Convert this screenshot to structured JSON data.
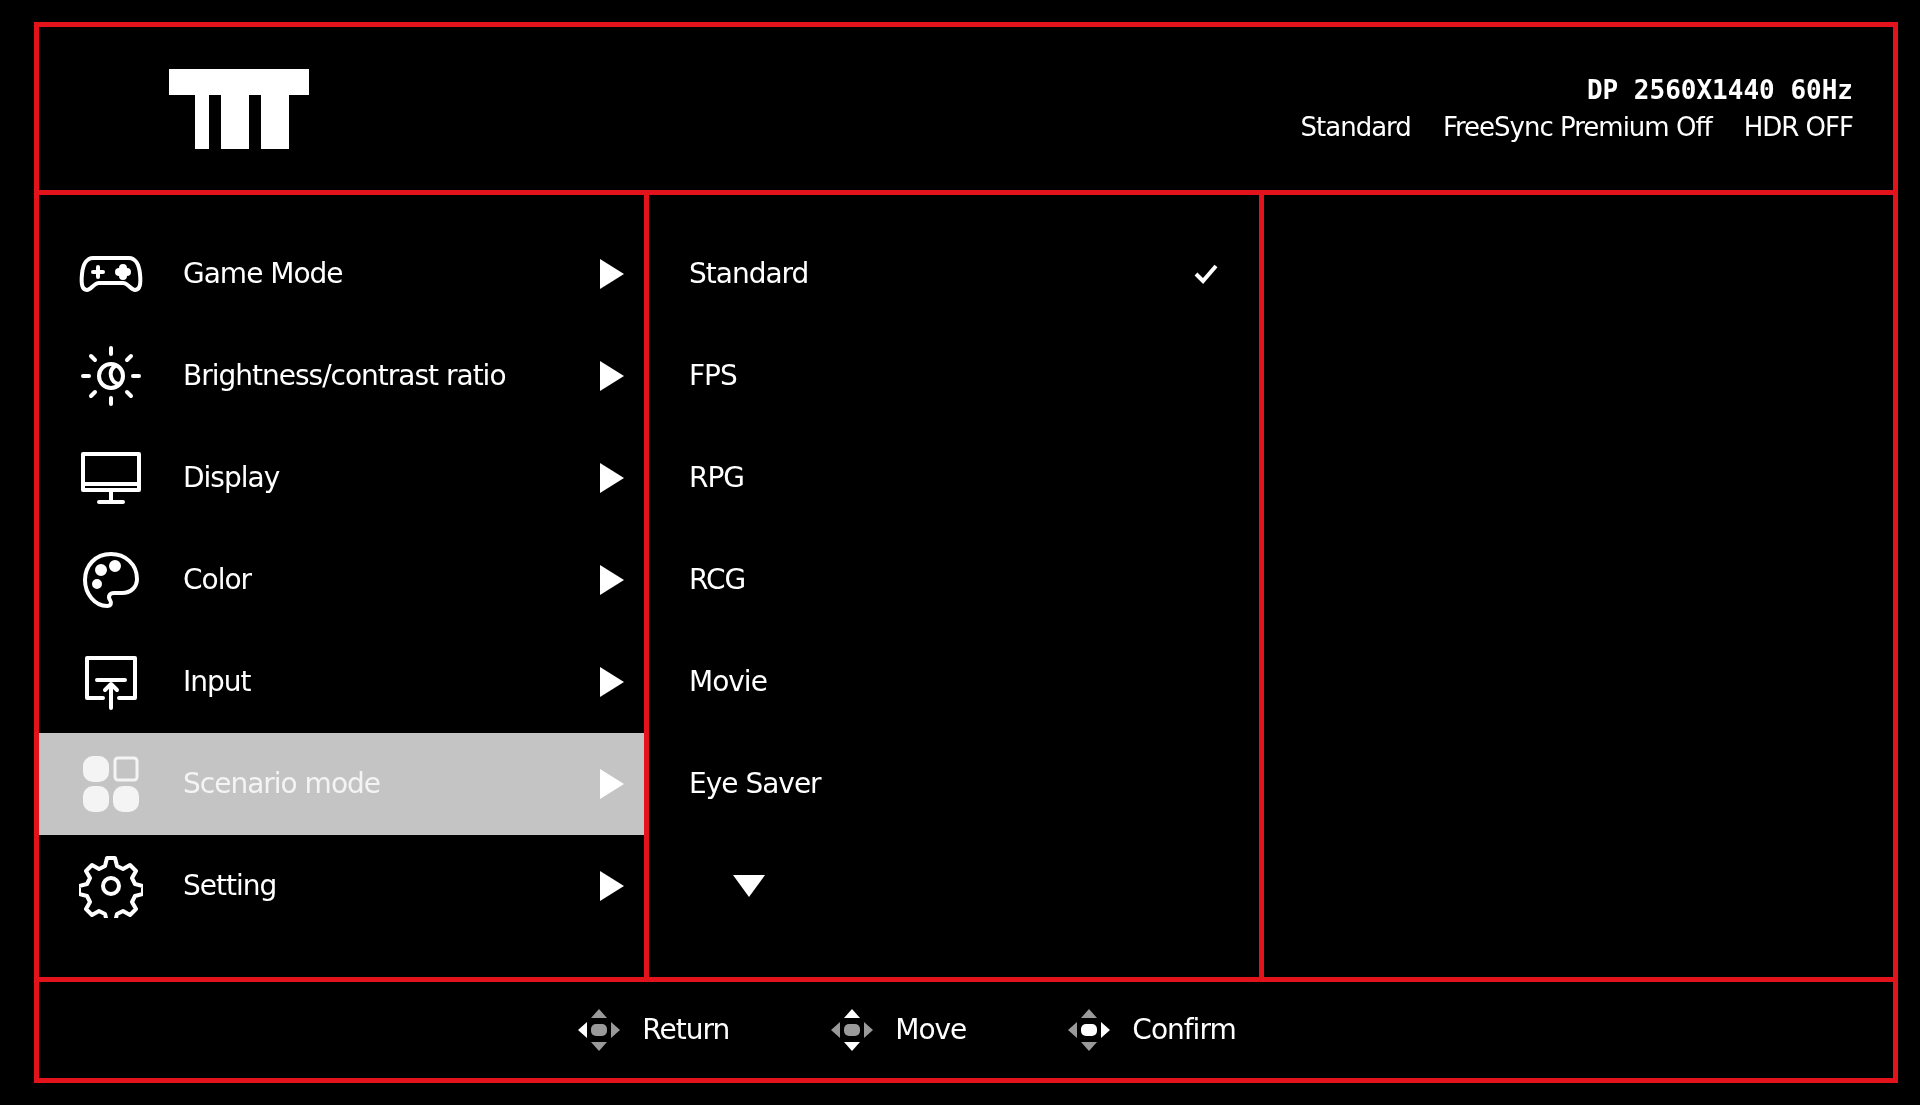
{
  "header": {
    "signal": "DP 2560X1440 60Hz",
    "status": [
      "Standard",
      "FreeSync Premium Off",
      "HDR OFF"
    ]
  },
  "menu": [
    {
      "kind": "gamepad",
      "label": "Game Mode",
      "selected": false
    },
    {
      "kind": "brightness",
      "label": "Brightness/contrast ratio",
      "selected": false
    },
    {
      "kind": "display",
      "label": "Display",
      "selected": false
    },
    {
      "kind": "color",
      "label": "Color",
      "selected": false
    },
    {
      "kind": "input",
      "label": "Input",
      "selected": false
    },
    {
      "kind": "scenario",
      "label": "Scenario mode",
      "selected": true
    },
    {
      "kind": "setting",
      "label": "Setting",
      "selected": false
    }
  ],
  "submenu": [
    {
      "label": "Standard",
      "checked": true
    },
    {
      "label": "FPS",
      "checked": false
    },
    {
      "label": "RPG",
      "checked": false
    },
    {
      "label": "RCG",
      "checked": false
    },
    {
      "label": "Movie",
      "checked": false
    },
    {
      "label": "Eye Saver",
      "checked": false
    }
  ],
  "more_below": true,
  "hints": [
    {
      "kind": "left",
      "label": "Return"
    },
    {
      "kind": "updown",
      "label": "Move"
    },
    {
      "kind": "right",
      "label": "Confirm"
    }
  ]
}
